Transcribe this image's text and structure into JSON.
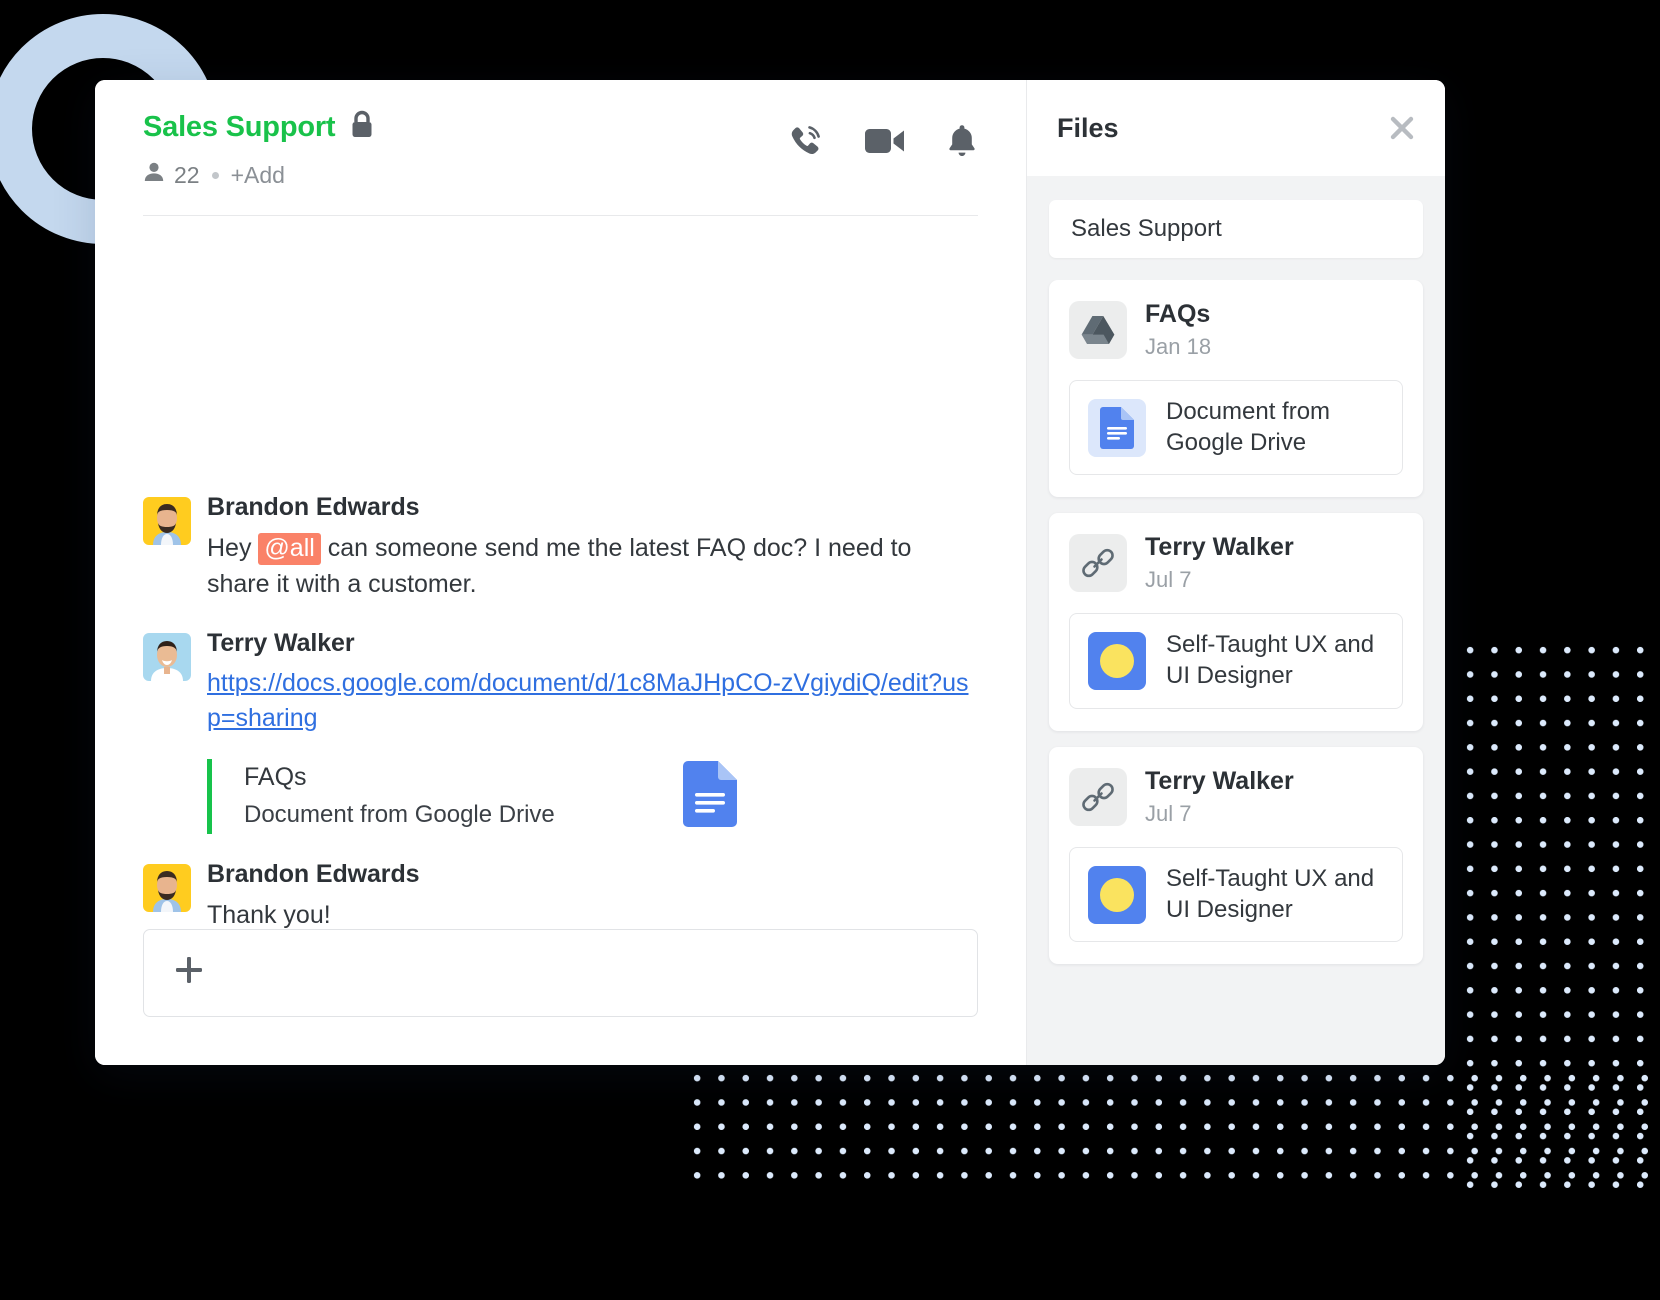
{
  "chat": {
    "title": "Sales Support",
    "lock_icon": "lock-icon",
    "member_count": "22",
    "add_label": "+Add",
    "actions": [
      {
        "name": "call-icon",
        "label": "Call"
      },
      {
        "name": "video-icon",
        "label": "Video"
      },
      {
        "name": "bell-icon",
        "label": "Notifications"
      }
    ],
    "messages": [
      {
        "author": "Brandon Edwards",
        "avatar": "avatar-brandon",
        "text_before": "Hey ",
        "mention": "@all",
        "text_after": " can someone send me the latest FAQ doc? I need to share it with a customer."
      },
      {
        "author": "Terry Walker",
        "avatar": "avatar-terry",
        "link": "https://docs.google.com/document/d/1c8MaJHpCO-zVgiydiQ/edit?usp=sharing",
        "attachment": {
          "title": "FAQs",
          "subtitle": "Document from Google Drive",
          "icon": "google-docs-icon"
        }
      },
      {
        "author": "Brandon Edwards",
        "avatar": "avatar-brandon",
        "text_before": "Thank you!",
        "mention": "",
        "text_after": ""
      }
    ],
    "composer": {
      "add_icon": "plus-icon",
      "placeholder": ""
    }
  },
  "files_panel": {
    "title": "Files",
    "close_icon": "close-icon",
    "search_value": "Sales Support",
    "cards": [
      {
        "source_icon": "google-drive-icon",
        "name": "FAQs",
        "date": "Jan 18",
        "item_thumb": "google-docs-icon",
        "item_label": "Document from Google Drive"
      },
      {
        "source_icon": "link-icon",
        "name": "Terry Walker",
        "date": "Jul 7",
        "item_thumb": "blue-yellow-thumb",
        "item_label": "Self-Taught UX and UI Designer"
      },
      {
        "source_icon": "link-icon",
        "name": "Terry Walker",
        "date": "Jul 7",
        "item_thumb": "blue-yellow-thumb",
        "item_label": "Self-Taught UX and UI Designer"
      }
    ]
  },
  "colors": {
    "brand_green": "#19c24a",
    "mention_bg": "#fa8268",
    "link_blue": "#2f6fe0",
    "accent_blue": "#5182ee",
    "deco_blue": "#cfe4fb"
  }
}
